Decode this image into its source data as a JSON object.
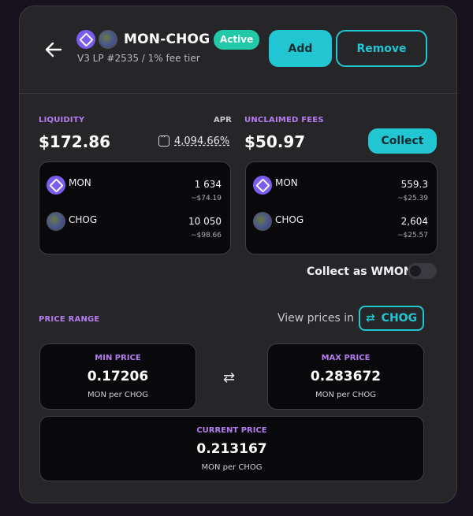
{
  "header": {
    "pair": "MON-CHOG",
    "status": "Active",
    "subtitle": "V3 LP #2535 / 1% fee tier",
    "add_label": "Add",
    "remove_label": "Remove"
  },
  "liquidity": {
    "label": "LIQUIDITY",
    "value": "$172.86",
    "apr_label": "APR",
    "apr_value": "4,094.66%",
    "tokens": [
      {
        "name": "MON",
        "amount": "1 634",
        "usd": "~$74.19",
        "icon": "mon-token-icon"
      },
      {
        "name": "CHOG",
        "amount": "10 050",
        "usd": "~$98.66",
        "icon": "chog-token-icon"
      }
    ]
  },
  "fees": {
    "label": "UNCLAIMED FEES",
    "value": "$50.97",
    "collect_label": "Collect",
    "tokens": [
      {
        "name": "MON",
        "amount": "559.3",
        "usd": "~$25.39",
        "icon": "mon-token-icon"
      },
      {
        "name": "CHOG",
        "amount": "2,604",
        "usd": "~$25.57",
        "icon": "chog-token-icon"
      }
    ],
    "collect_wmon_label": "Collect as WMON",
    "collect_wmon_enabled": false
  },
  "price_range": {
    "label": "PRICE RANGE",
    "view_prices_label": "View prices in",
    "view_token": "CHOG",
    "min": {
      "label": "MIN PRICE",
      "value": "0.17206",
      "unit": "MON per CHOG"
    },
    "max": {
      "label": "MAX PRICE",
      "value": "0.283672",
      "unit": "MON per CHOG"
    },
    "current": {
      "label": "CURRENT PRICE",
      "value": "0.213167",
      "unit": "MON per CHOG"
    }
  },
  "colors": {
    "accent": "#22c6d3",
    "active_badge": "#22c9a8",
    "label_purple": "#b57cf2"
  }
}
